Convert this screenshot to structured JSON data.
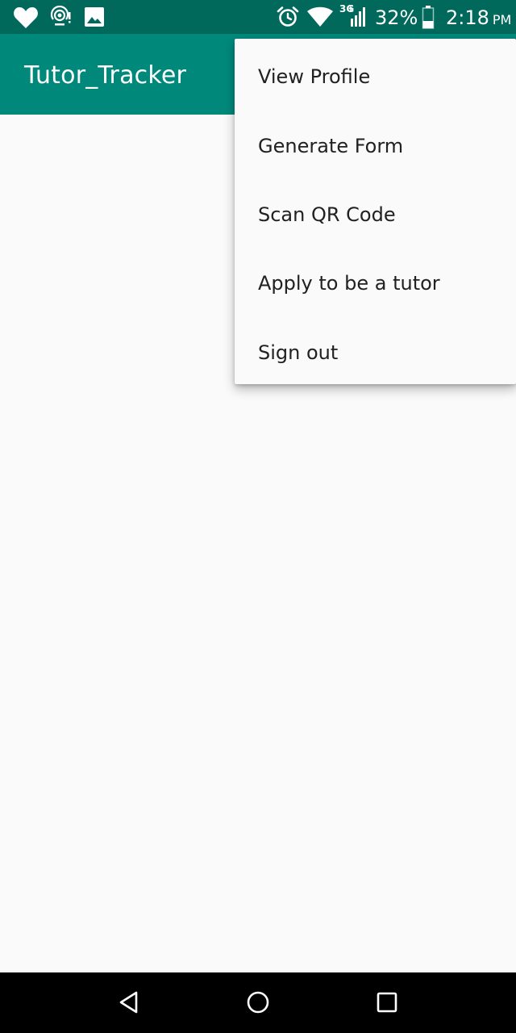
{
  "status_bar": {
    "icons": [
      "heart-icon",
      "hotspot-icon",
      "image-icon",
      "alarm-icon",
      "wifi-icon",
      "signal-icon",
      "battery-icon"
    ],
    "network_type": "3G",
    "battery_percent": "32%",
    "time": "2:18",
    "ampm": "PM",
    "color": "#00695c"
  },
  "app_bar": {
    "title": "Tutor_Tracker",
    "color": "#00897b"
  },
  "overflow_menu": {
    "items": [
      {
        "label": "View Profile"
      },
      {
        "label": "Generate Form"
      },
      {
        "label": "Scan QR Code"
      },
      {
        "label": "Apply to be a tutor"
      },
      {
        "label": "Sign out"
      }
    ]
  },
  "nav_bar": {
    "icons": [
      "back-icon",
      "home-icon",
      "recents-icon"
    ]
  }
}
